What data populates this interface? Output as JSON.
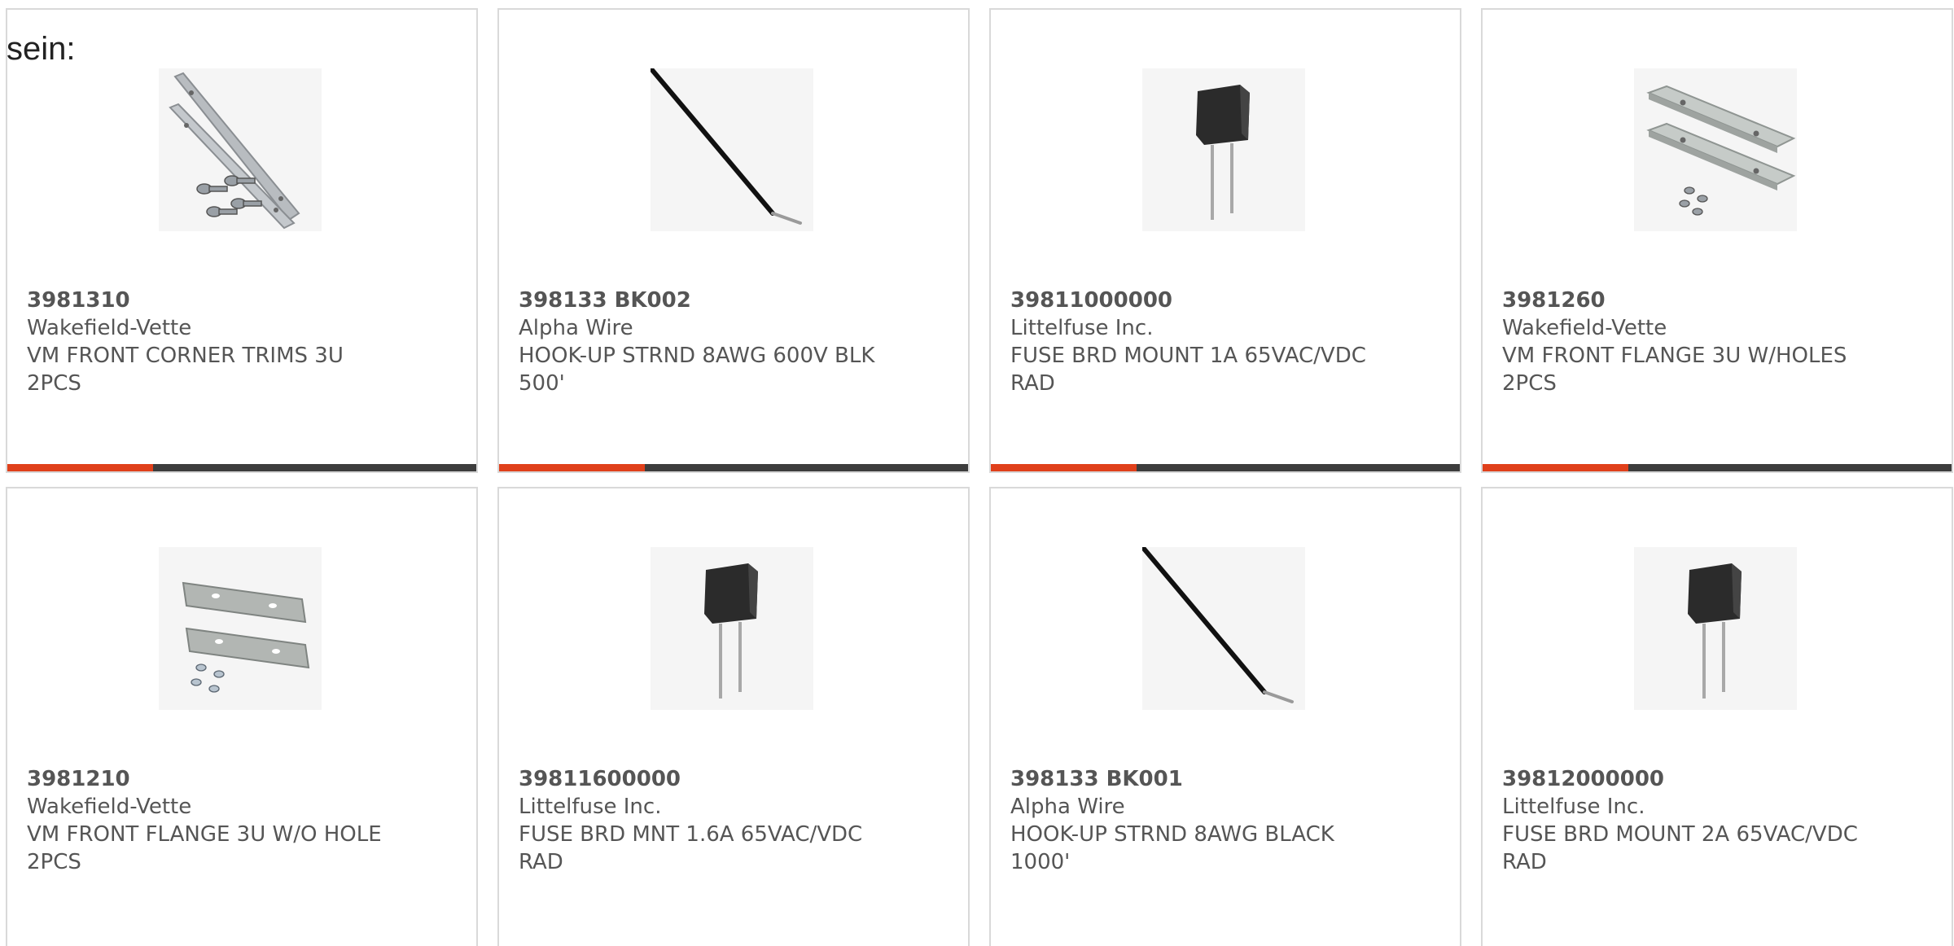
{
  "heading": "sein:",
  "colors": {
    "accent": "#e0401b",
    "bar_track": "#3d3d3d",
    "text": "#555555",
    "border": "#d9d9d9"
  },
  "products": [
    {
      "part_number": "3981310",
      "manufacturer": "Wakefield-Vette",
      "description": "VM FRONT CORNER TRIMS 3U 2PCS",
      "image": "metal-trims-with-screws",
      "progress": 0.31
    },
    {
      "part_number": "398133 BK002",
      "manufacturer": "Alpha Wire",
      "description": "HOOK-UP STRND 8AWG 600V BLK 500'",
      "image": "black-wire",
      "progress": 0.31
    },
    {
      "part_number": "39811000000",
      "manufacturer": "Littelfuse Inc.",
      "description": "FUSE BRD MOUNT 1A 65VAC/VDC RAD",
      "image": "radial-fuse",
      "progress": 0.31
    },
    {
      "part_number": "3981260",
      "manufacturer": "Wakefield-Vette",
      "description": "VM FRONT FLANGE 3U W/HOLES 2PCS",
      "image": "flanges-with-holes",
      "progress": 0.31
    },
    {
      "part_number": "3981210",
      "manufacturer": "Wakefield-Vette",
      "description": "VM FRONT FLANGE 3U W/O HOLE 2PCS",
      "image": "flanges-without-holes"
    },
    {
      "part_number": "39811600000",
      "manufacturer": "Littelfuse Inc.",
      "description": "FUSE BRD MNT 1.6A 65VAC/VDC RAD",
      "image": "radial-fuse"
    },
    {
      "part_number": "398133 BK001",
      "manufacturer": "Alpha Wire",
      "description": "HOOK-UP STRND 8AWG BLACK 1000'",
      "image": "black-wire"
    },
    {
      "part_number": "39812000000",
      "manufacturer": "Littelfuse Inc.",
      "description": "FUSE BRD MOUNT 2A 65VAC/VDC RAD",
      "image": "radial-fuse"
    }
  ]
}
